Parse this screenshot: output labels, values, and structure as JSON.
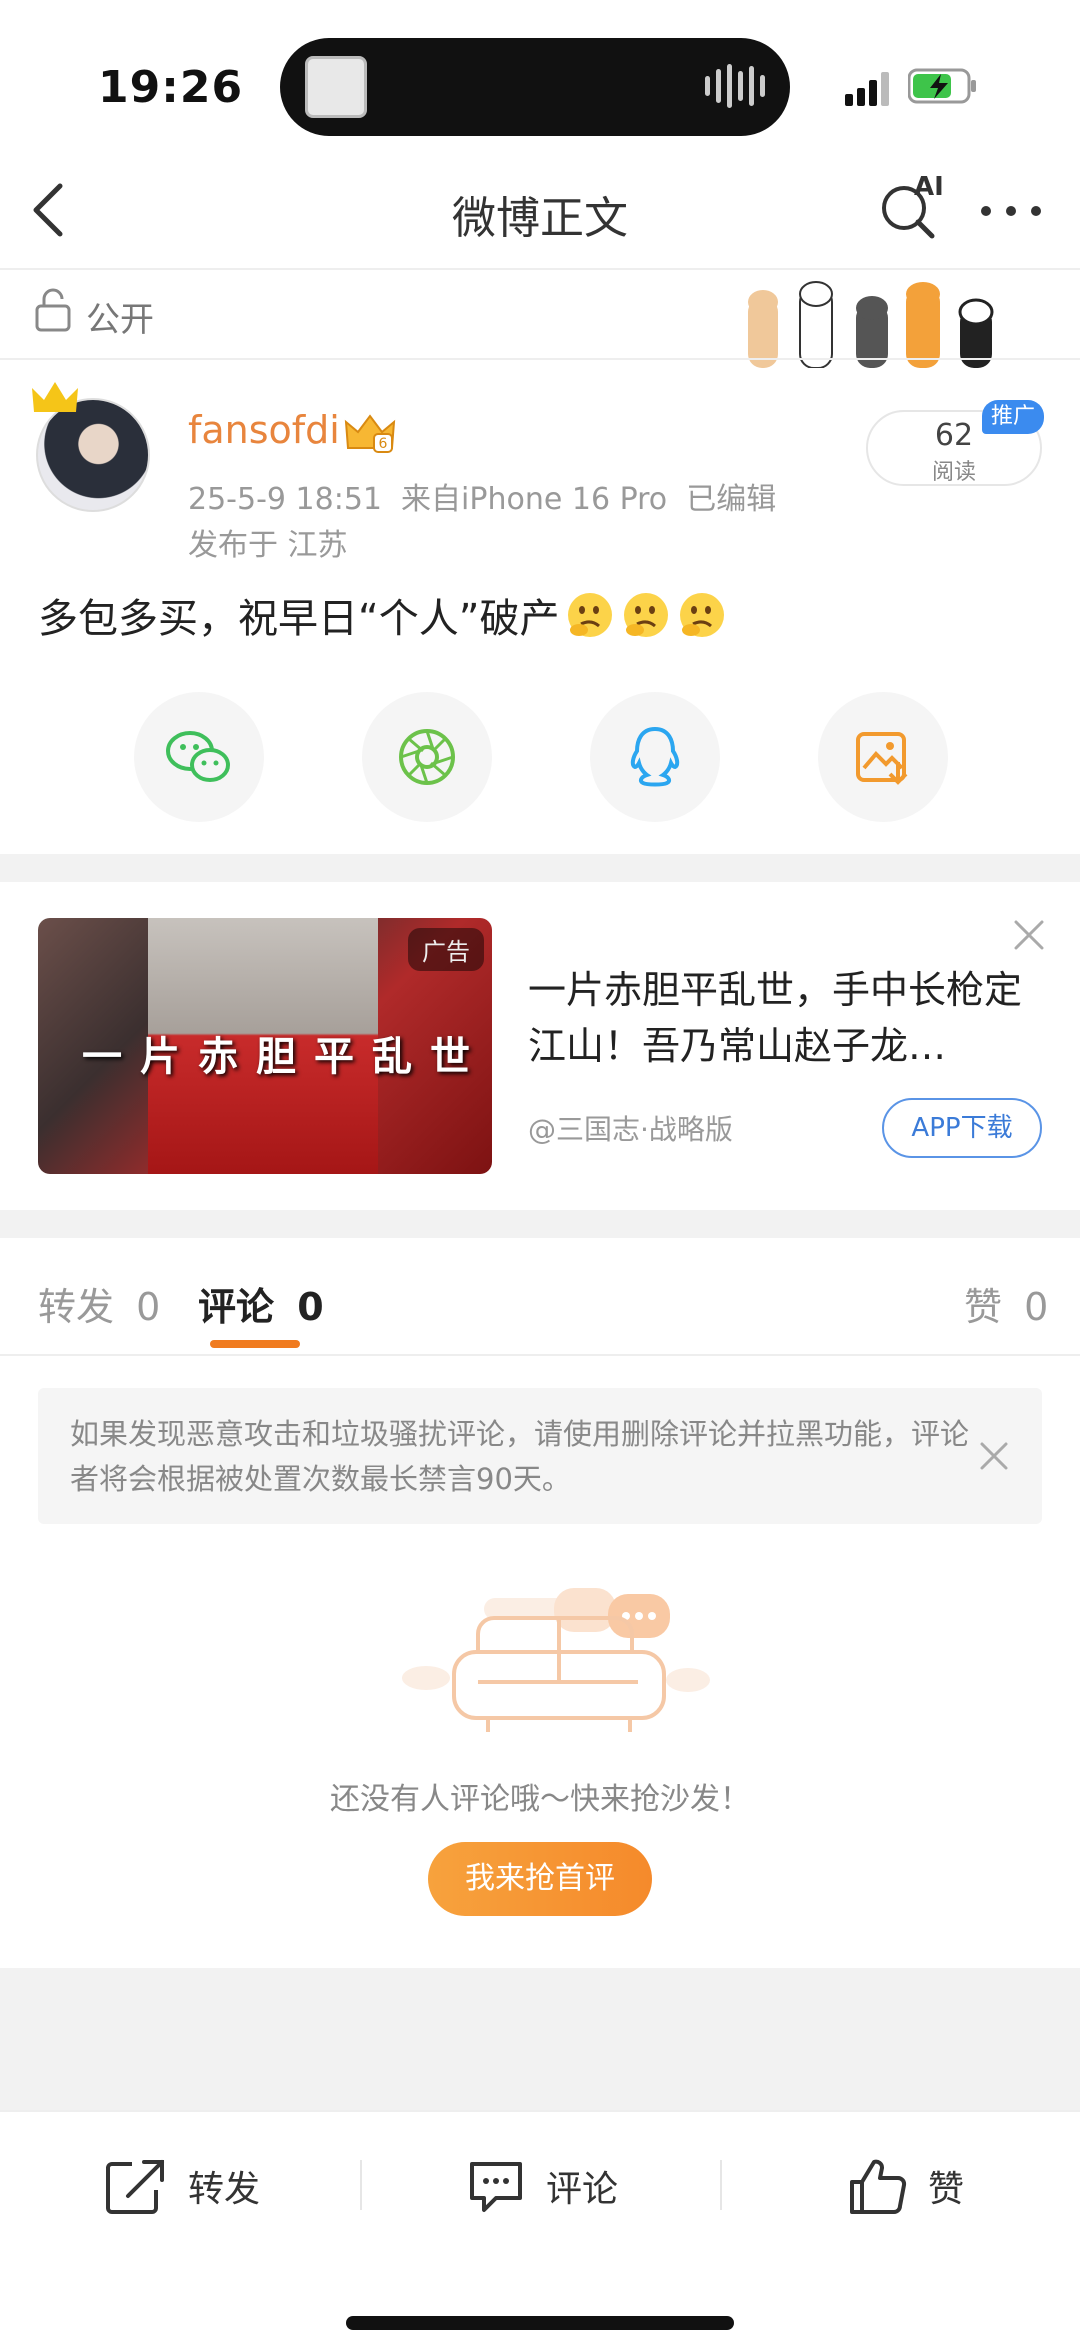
{
  "status_bar": {
    "time": "19:26"
  },
  "nav": {
    "title": "微博正文",
    "ai_label": "AI"
  },
  "visibility": {
    "label": "公开"
  },
  "post": {
    "author": "fansofdi",
    "meta": "25-5-9 18:51  来自iPhone 16 Pro  已编辑",
    "location": "发布于 江苏",
    "read_count": "62",
    "read_label": "阅读",
    "promo_tag": "推广",
    "text": "多包多买，祝早日“个人”破产",
    "emoji_count": 3
  },
  "share": {
    "items": [
      "wechat-icon",
      "moments-icon",
      "qq-icon",
      "save-image-icon"
    ]
  },
  "ad": {
    "tag": "广告",
    "overlay_text": "一片赤胆平乱世",
    "title": "一片赤胆平乱世，手中长枪定江山！吾乃常山赵子龙…",
    "source": "@三国志·战略版",
    "button": "APP下载"
  },
  "tabs": {
    "repost_label": "转发",
    "repost_count": "0",
    "comment_label": "评论",
    "comment_count": "0",
    "like_label": "赞",
    "like_count": "0"
  },
  "notice": {
    "text": "如果发现恶意攻击和垃圾骚扰评论，请使用删除评论并拉黑功能，评论者将会根据被处置次数最长禁言90天。"
  },
  "empty_state": {
    "text": "还没有人评论哦～快来抢沙发！",
    "button": "我来抢首评"
  },
  "bottom_bar": {
    "repost": "转发",
    "comment": "评论",
    "like": "赞"
  },
  "colors": {
    "accent_orange": "#f07b1f",
    "author_orange": "#e8853d",
    "link_blue": "#3b7bd8"
  }
}
